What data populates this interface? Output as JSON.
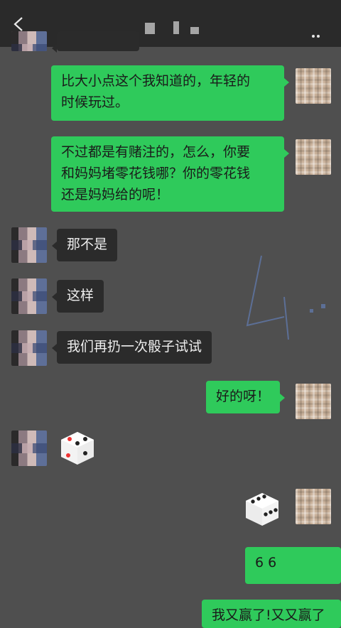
{
  "header": {
    "back_icon": "chevron-left-icon",
    "more_icon": "more-dots-icon"
  },
  "messages": [
    {
      "from": "me",
      "text": "比大小点这个我知道的，年轻的时候玩过。",
      "lines": [
        "比大小点这个我知道的，年轻的",
        "时候玩过。"
      ]
    },
    {
      "from": "me",
      "text": "不过都是有赌注的，怎么，你要和妈妈堵零花钱哪？你的零花钱还是妈妈给的呢！",
      "lines": [
        "不过都是有赌注的，怎么，你要",
        "和妈妈堵零花钱哪？你的零花钱",
        "还是妈妈给的呢！"
      ]
    },
    {
      "from": "other",
      "text": "那不是"
    },
    {
      "from": "other",
      "text": "这样"
    },
    {
      "from": "other",
      "text": "我们再扔一次骰子试试"
    },
    {
      "from": "me",
      "text": "好的呀！"
    },
    {
      "from": "other",
      "type": "dice",
      "value": 4
    },
    {
      "from": "me",
      "type": "dice",
      "value": 6
    },
    {
      "from": "me",
      "text": "6 6"
    },
    {
      "from": "me",
      "text": "我又赢了!又又赢了"
    }
  ]
}
